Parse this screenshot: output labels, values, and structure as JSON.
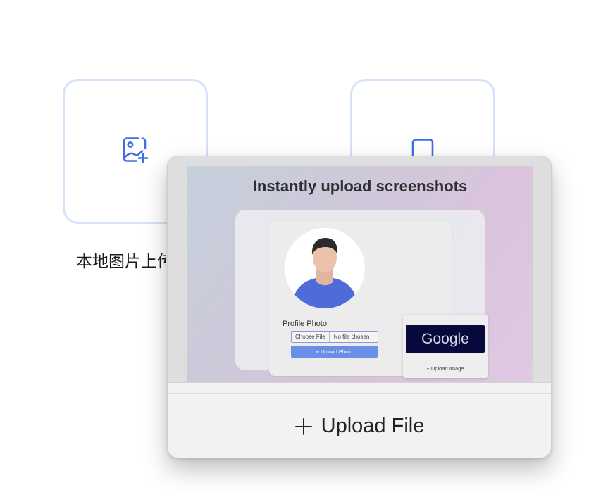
{
  "tiles": {
    "local": {
      "label": "本地图片上传",
      "icon": "image-plus-icon"
    },
    "other": {
      "icon": "square-icon"
    }
  },
  "popup": {
    "preview": {
      "title": "Instantly upload screenshots",
      "profile_label": "Profile Photo",
      "choose_file": "Choose File",
      "no_file": "No file chosen",
      "upload_photo": "+ Upload Photo",
      "google_logo": "Google",
      "upload_image": "+ Upload Image"
    },
    "upload_button": {
      "label": "Upload File",
      "icon": "plus-icon"
    }
  },
  "colors": {
    "accent": "#3f6fe0",
    "tile_border": "#d6e1fb",
    "google_banner": "#07083b",
    "upload_photo_button": "#6b8fe6"
  }
}
